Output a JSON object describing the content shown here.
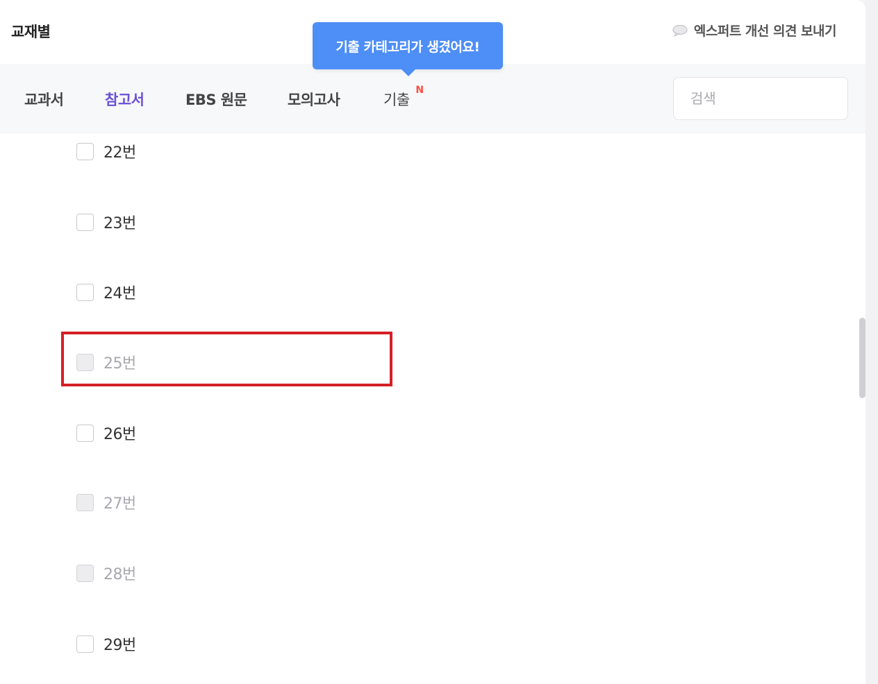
{
  "header": {
    "title": "교재별",
    "feedback_label": "엑스퍼트 개선 의견 보내기",
    "feedback_icon": "speech-bubble-icon"
  },
  "tooltip": {
    "text": "기출 카테고리가 생겼어요!"
  },
  "tabs": [
    {
      "label": "교과서",
      "active": false
    },
    {
      "label": "참고서",
      "active": true
    },
    {
      "label": "EBS 원문",
      "active": false
    },
    {
      "label": "모의고사",
      "active": false
    },
    {
      "label": "기출",
      "active": false,
      "badge": "N"
    }
  ],
  "search": {
    "placeholder": "검색",
    "value": ""
  },
  "items": [
    {
      "label": "22번",
      "disabled": false
    },
    {
      "label": "23번",
      "disabled": false
    },
    {
      "label": "24번",
      "disabled": false
    },
    {
      "label": "25번",
      "disabled": true,
      "highlighted": true
    },
    {
      "label": "26번",
      "disabled": false
    },
    {
      "label": "27번",
      "disabled": true
    },
    {
      "label": "28번",
      "disabled": true
    },
    {
      "label": "29번",
      "disabled": false
    }
  ],
  "colors": {
    "active_tab": "#6a4fd6",
    "tooltip_bg": "#4d8ef7",
    "new_badge": "#ff4b3e",
    "highlight": "#d61f26"
  }
}
